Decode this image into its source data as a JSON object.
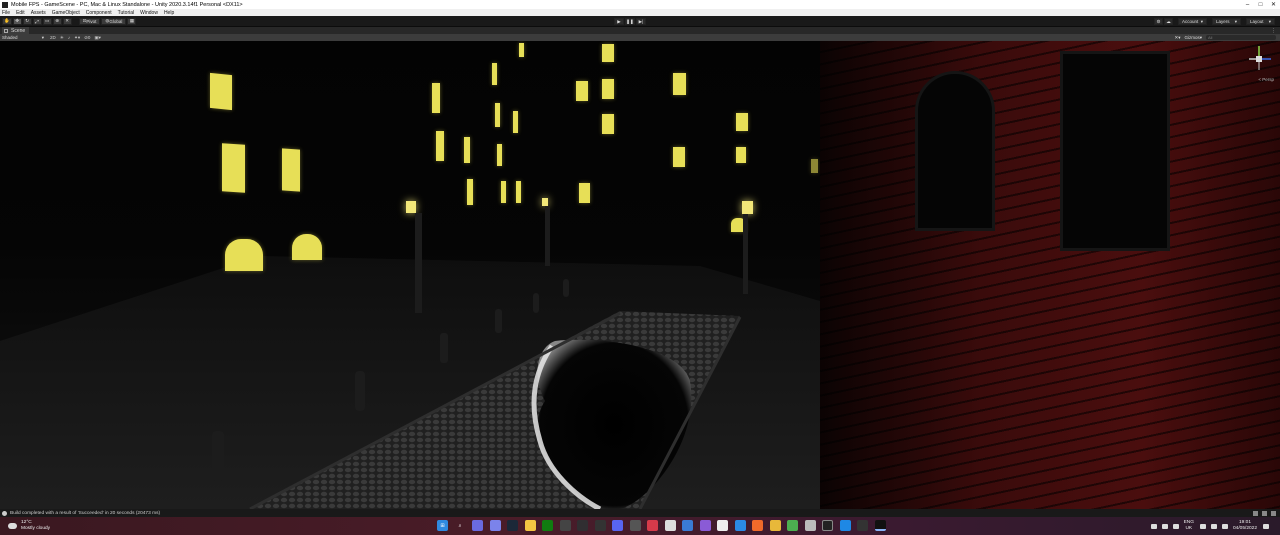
{
  "window": {
    "title": "Mobile FPS - GameScene - PC, Mac & Linux Standalone - Unity 2020.3.14f1 Personal <DX11>",
    "minimize": "–",
    "maximize": "□",
    "close": "✕"
  },
  "menu": [
    "File",
    "Edit",
    "Assets",
    "GameObject",
    "Component",
    "Tutorial",
    "Window",
    "Help"
  ],
  "toolbar": {
    "pivot_label": "Pivot",
    "global_label": "Global",
    "account_label": "Account",
    "layers_label": "Layers",
    "layout_label": "Layout"
  },
  "scene": {
    "tab_label": "Scene",
    "shading_mode": "Shaded",
    "mode_2d": "2D",
    "gizmos_label": "Gizmos",
    "search_placeholder": "All",
    "persp_label": "< Persp"
  },
  "status": {
    "message": "Build completed with a result of 'Succeeded' in 20 seconds (20473 ms)"
  },
  "taskbar": {
    "weather_temp": "12°C",
    "weather_desc": "Mostly cloudy",
    "lang_primary": "ENG",
    "lang_secondary": "UK",
    "time": "19:01",
    "date": "04/05/2022"
  },
  "colors": {
    "window_light": "#e7df57",
    "brick": "#4a0e0e",
    "editor_dark": "#191919"
  }
}
